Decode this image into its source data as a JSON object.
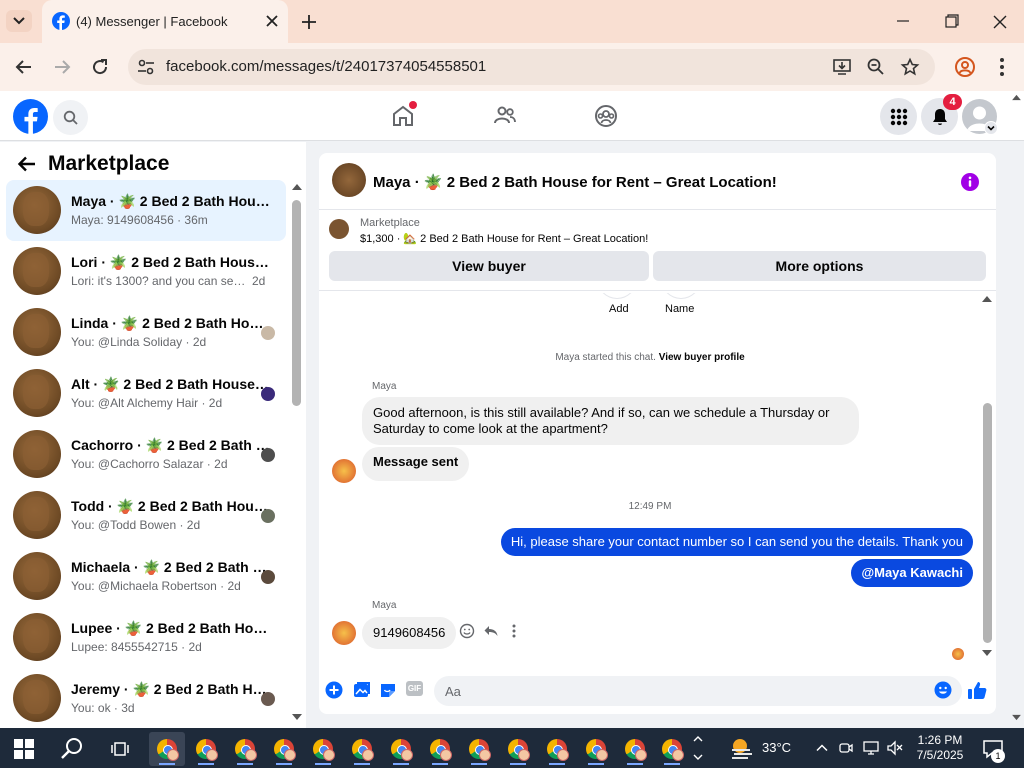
{
  "browser": {
    "tab_title": "(4) Messenger | Facebook",
    "url": "facebook.com/messages/t/24017374054558501"
  },
  "header": {
    "notification_count": "4"
  },
  "marketplace": {
    "title": "Marketplace",
    "conversations": [
      {
        "name": "Maya · 🪴 2 Bed 2 Bath House f...",
        "sub": "Maya: 9149608456 · 36m",
        "active": true
      },
      {
        "name": "Lori · 🪴 2 Bed 2 Bath House fo...",
        "sub": "Lori: it's 1300? and you can send i...",
        "time": "2d"
      },
      {
        "name": "Linda · 🪴 2 Bed 2 Bath House...",
        "sub": "You: @Linda Soliday · 2d"
      },
      {
        "name": "Alt · 🪴 2 Bed 2 Bath House f...",
        "sub": "You: @Alt Alchemy Hair · 2d"
      },
      {
        "name": "Cachorro · 🪴 2 Bed 2 Bath H...",
        "sub": "You: @Cachorro Salazar · 2d"
      },
      {
        "name": "Todd · 🪴 2 Bed 2 Bath Hous...",
        "sub": "You: @Todd Bowen · 2d"
      },
      {
        "name": "Michaela · 🪴 2 Bed 2 Bath H...",
        "sub": "You: @Michaela Robertson · 2d"
      },
      {
        "name": "Lupee · 🪴 2 Bed 2 Bath House ...",
        "sub": "Lupee: 8455542715 · 2d"
      },
      {
        "name": "Jeremy · 🪴 2 Bed 2 Bath Ho...",
        "sub": "You: ok · 3d"
      }
    ]
  },
  "chat": {
    "title": "Maya · 🪴 2 Bed 2 Bath House for Rent – Great Location!",
    "listing": {
      "label": "Marketplace",
      "price_line": "$1,300 · 🏡 2 Bed 2 Bath House for Rent – Great Location!"
    },
    "view_buyer": "View buyer",
    "more_options": "More options",
    "add_label": "Add",
    "name_label": "Name",
    "started_text": "Maya started this chat. ",
    "view_buyer_profile": "View buyer profile",
    "sender1": "Maya",
    "msg1": "Good afternoon, is this still available? And if so, can we schedule a Thursday or Saturday to come look at the apartment?",
    "msg2": "Message sent",
    "timestamp": "12:49 PM",
    "msg3": "Hi, please share your contact number so I can send you the details. Thank you",
    "msg4": "@Maya Kawachi",
    "sender2": "Maya",
    "msg5": "9149608456",
    "composer_placeholder": "Aa"
  },
  "taskbar": {
    "temperature": "33°C",
    "time": "1:26 PM",
    "date": "7/5/2025",
    "notification_count": "1"
  },
  "colors": {
    "fb_blue": "#0866ff",
    "out_bubble": "#0a49e0",
    "info_purple": "#a100e6"
  }
}
